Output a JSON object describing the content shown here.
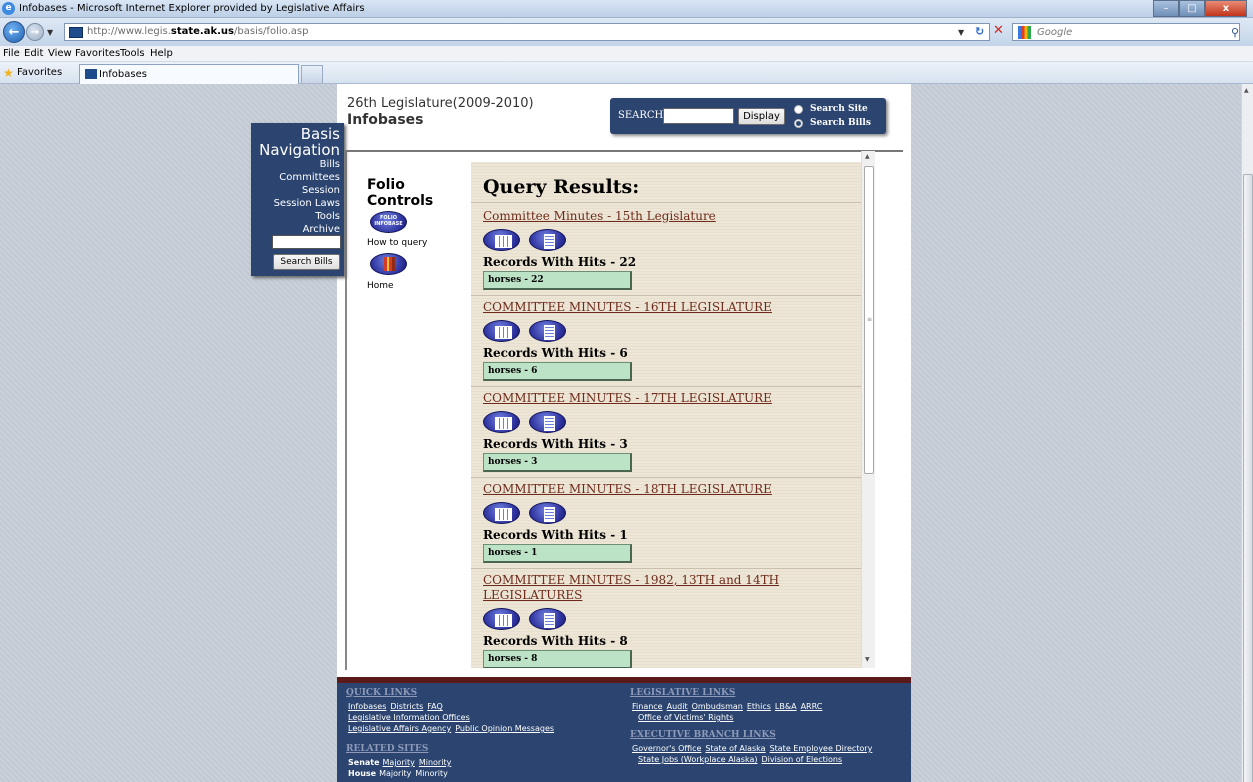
{
  "window": {
    "title": "Infobases - Microsoft Internet Explorer provided by Legislative Affairs",
    "controls": {
      "minimize": "–",
      "maximize": "□",
      "close": "x"
    }
  },
  "addressbar": {
    "url_prefix": "http://www.legis.",
    "url_domain": "state.ak.us",
    "url_path": "/basis/folio.asp",
    "search_placeholder": "Google"
  },
  "menu": [
    "File",
    "Edit",
    "View",
    "Favorites",
    "Tools",
    "Help"
  ],
  "favorites": {
    "label": "Favorites",
    "tab_label": "Infobases"
  },
  "page": {
    "legislature": "26th Legislature(2009-2010)",
    "title": "Infobases",
    "search": {
      "label": "SEARCH",
      "button": "Display",
      "options": [
        {
          "label": "Search Site",
          "checked": false
        },
        {
          "label": "Search Bills",
          "checked": true
        }
      ]
    },
    "basis_nav": {
      "title_line1": "Basis",
      "title_line2": "Navigation",
      "links": [
        "Bills",
        "Committees",
        "Session",
        "Session Laws",
        "Tools",
        "Archive"
      ],
      "search_button": "Search Bills"
    },
    "folio": {
      "title_line1": "Folio",
      "title_line2": "Controls",
      "folio_icon_text": "FOLIO INFOBASE",
      "how_to": "How to query",
      "home": "Home"
    },
    "results": {
      "heading": "Query Results:",
      "items": [
        {
          "title": "Committee Minutes - 15th Legislature",
          "hits_label": "Records With Hits - 22",
          "term": "horses - 22"
        },
        {
          "title": "COMMITTEE MINUTES - 16TH LEGISLATURE",
          "hits_label": "Records With Hits - 6",
          "term": "horses - 6"
        },
        {
          "title": "COMMITTEE MINUTES - 17TH LEGISLATURE",
          "hits_label": "Records With Hits - 3",
          "term": "horses - 3"
        },
        {
          "title": "COMMITTEE MINUTES - 18TH LEGISLATURE",
          "hits_label": "Records With Hits - 1",
          "term": "horses - 1"
        },
        {
          "title": "COMMITTEE MINUTES - 1982, 13TH and 14TH LEGISLATURES",
          "hits_label": "Records With Hits - 8",
          "term": "horses - 8"
        }
      ]
    },
    "footer": {
      "quick_links": {
        "heading": "QUICK LINKS",
        "row1": [
          "Infobases",
          "Districts",
          "FAQ"
        ],
        "row2": [
          "Legislative Information Offices"
        ],
        "row3": [
          "Legislative Affairs Agency",
          "Public Opinion Messages"
        ]
      },
      "related_sites": {
        "heading": "RELATED SITES",
        "senate": {
          "label": "Senate",
          "links": [
            "Majority",
            "Minority"
          ]
        },
        "house": {
          "label": "House",
          "links": [
            "Majority",
            "Minority"
          ]
        }
      },
      "legislative_links": {
        "heading": "LEGISLATIVE LINKS",
        "row1": [
          "Finance",
          "Audit",
          "Ombudsman",
          "Ethics",
          "LB&A",
          "ARRC"
        ],
        "row2": [
          "Office of Victims' Rights"
        ]
      },
      "executive_links": {
        "heading": "EXECUTIVE BRANCH LINKS",
        "row1": [
          "Governor's Office",
          "State of Alaska",
          "State Employee Directory"
        ],
        "row2": [
          "State Jobs (Workplace Alaska)",
          "Division of Elections"
        ]
      }
    }
  },
  "colors": {
    "panel_blue": "#2b4570",
    "link_maroon": "#6e2a1a",
    "hit_green": "#bde3c7",
    "results_bg": "#ede6d6"
  }
}
